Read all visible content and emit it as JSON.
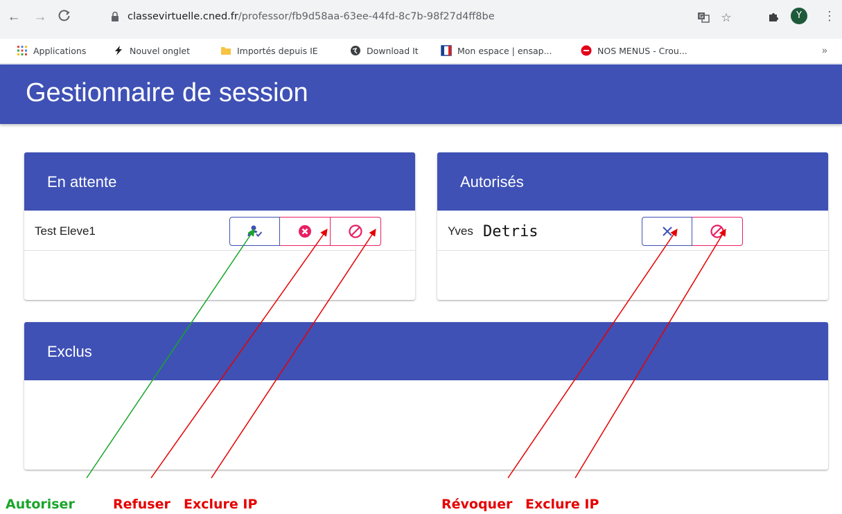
{
  "browser": {
    "url_domain": "classevirtuelle.cned.fr",
    "url_path": "/professor/fb9d58aa-63ee-44fd-8c7b-98f27d4ff8be",
    "profile_initial": "Y",
    "bookmarks": [
      {
        "label": "Applications",
        "icon": "apps-grid-icon"
      },
      {
        "label": "Nouvel onglet",
        "icon": "lightning-icon"
      },
      {
        "label": "Importés depuis IE",
        "icon": "folder-icon"
      },
      {
        "label": "Download It",
        "icon": "globe-icon"
      },
      {
        "label": "Mon espace | ensap...",
        "icon": "ensap-icon"
      },
      {
        "label": "NOS MENUS - Crou...",
        "icon": "crous-icon"
      }
    ],
    "more_label": "»"
  },
  "app": {
    "title": "Gestionnaire de session",
    "accent_color": "#3f51b5",
    "danger_color": "#e91e63"
  },
  "panels": {
    "waiting": {
      "title": "En attente",
      "students": [
        {
          "name": "Test Eleve1"
        }
      ]
    },
    "authorized": {
      "title": "Autorisés",
      "students": [
        {
          "name": "Yves",
          "overlay": "Detris"
        }
      ]
    },
    "excluded": {
      "title": "Exclus",
      "students": []
    }
  },
  "annotations": [
    {
      "label": "Autoriser",
      "color": "#1aa52a"
    },
    {
      "label": "Refuser",
      "color": "#e60000"
    },
    {
      "label": "Exclure IP",
      "color": "#e60000"
    },
    {
      "label": "Révoquer",
      "color": "#e60000"
    },
    {
      "label": "Exclure IP",
      "color": "#e60000"
    }
  ]
}
